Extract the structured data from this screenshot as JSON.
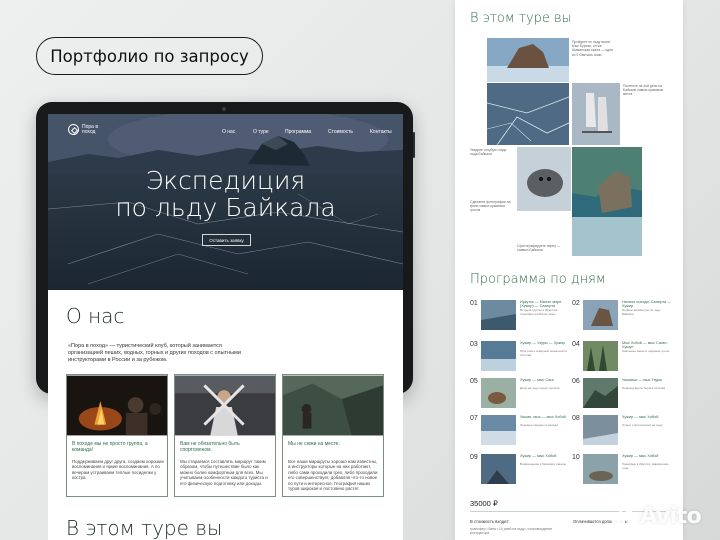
{
  "badge": {
    "label": "Портфолио по запросу"
  },
  "site": {
    "logo_text": "Пора в поход",
    "nav": [
      "О нас",
      "О туре",
      "Программа",
      "Стоимость",
      "Контакты"
    ],
    "hero_title_1": "Экспедиция",
    "hero_title_2": "по льду Байкала",
    "hero_button": "Оставить заявку",
    "about_title": "О нас",
    "about_text": "«Пора в поход» — туристический клуб, который занимается организацией пеших, водных, горных и других походов с опытными инструкторами в России и за рубежом.",
    "cards": [
      {
        "title": "В походе мы не просто группа, а команда!",
        "text": "Поддерживаем друг друга, создаем хорошие воспоминания и яркие воспоминания. А по вечерам устраиваем теплые посиделки у костра."
      },
      {
        "title": "Вам не обязательно быть спортсменом.",
        "text": "Мы стараемся составлять маршрут таким образом, чтобы путешествие было как можно более комфортным для всех. Мы учитываем особенности каждого туриста и его физическую подготовку или доходы."
      },
      {
        "title": "Мы не сюжи на месте.",
        "text": "Все наши маршруты хорошо нам известны, а инструкторы которые на них работают, либо сами проходили грех, либо проходили его совершенствует, добавляя что-то новое по пути и интересное. География наших туров широкая и постоянно растет."
      }
    ],
    "tour_title": "В этом туре вы"
  },
  "page": {
    "tour_title": "В этом туре вы",
    "program_title": "Программа по дням",
    "captions": [
      "Пройдете по льду возле Мыс Бурхан, он же Шаманская скала — одна из 9 Святынь Азии",
      "Посетите на 4ой день на Байкале самые красивые места",
      "Увидите голубую гладь льда Байкала",
      "Сделаете фотографии на фоне самых красивых гротов",
      "Сфотографируете нерпу — символ Байкала"
    ],
    "days": [
      {
        "n": "01",
        "title": "Иркутск — Малое море (Хужир) — Сахюрта",
        "text": "Встреча группы в Иркутске, трансфер на Малое море"
      },
      {
        "n": "02",
        "title": "Начало похода. Сахюрта — Хужир",
        "text": "Первые километры по льду Байкала"
      },
      {
        "n": "03",
        "title": "Хужир — Узуры — Хужир",
        "text": "Прогулка к северной оконечности острова"
      },
      {
        "n": "04",
        "title": "Мыс Хобой — мыс Саган-Хушун",
        "text": "Скальные мысы и ледяные гроты"
      },
      {
        "n": "05",
        "title": "Хужир — мыс Сага",
        "text": "День на льду среди торосов"
      },
      {
        "n": "06",
        "title": "Ушканьи — мыс Узуры",
        "text": "Переход вдоль берега острова"
      },
      {
        "n": "07",
        "title": "Ушкан. мыс — мыс Хобой",
        "text": "Ледовые пещеры и наледи"
      },
      {
        "n": "08",
        "title": "Хужир — мыс Хобой",
        "text": "Отдых и фотосессия на льду"
      },
      {
        "n": "09",
        "title": "Хужир — мыс Хобой",
        "text": "Возвращение к базовому лагерю"
      },
      {
        "n": "10",
        "title": "Хужир — мыс Хобой",
        "text": "Трансфер в Иркутск, завершение тура"
      }
    ],
    "price": "35000 ₽",
    "included_label": "В стоимость входит:",
    "included_text": "трансфер • баня • 10 дней на льду • сопровождение инструктора",
    "extra_label": "Оплачивается дополнительно:"
  },
  "watermark": {
    "text": "Avito"
  },
  "colors": {
    "accent": "#2e6b4a",
    "frame": "#17191b",
    "background": "#e6e8e8"
  }
}
